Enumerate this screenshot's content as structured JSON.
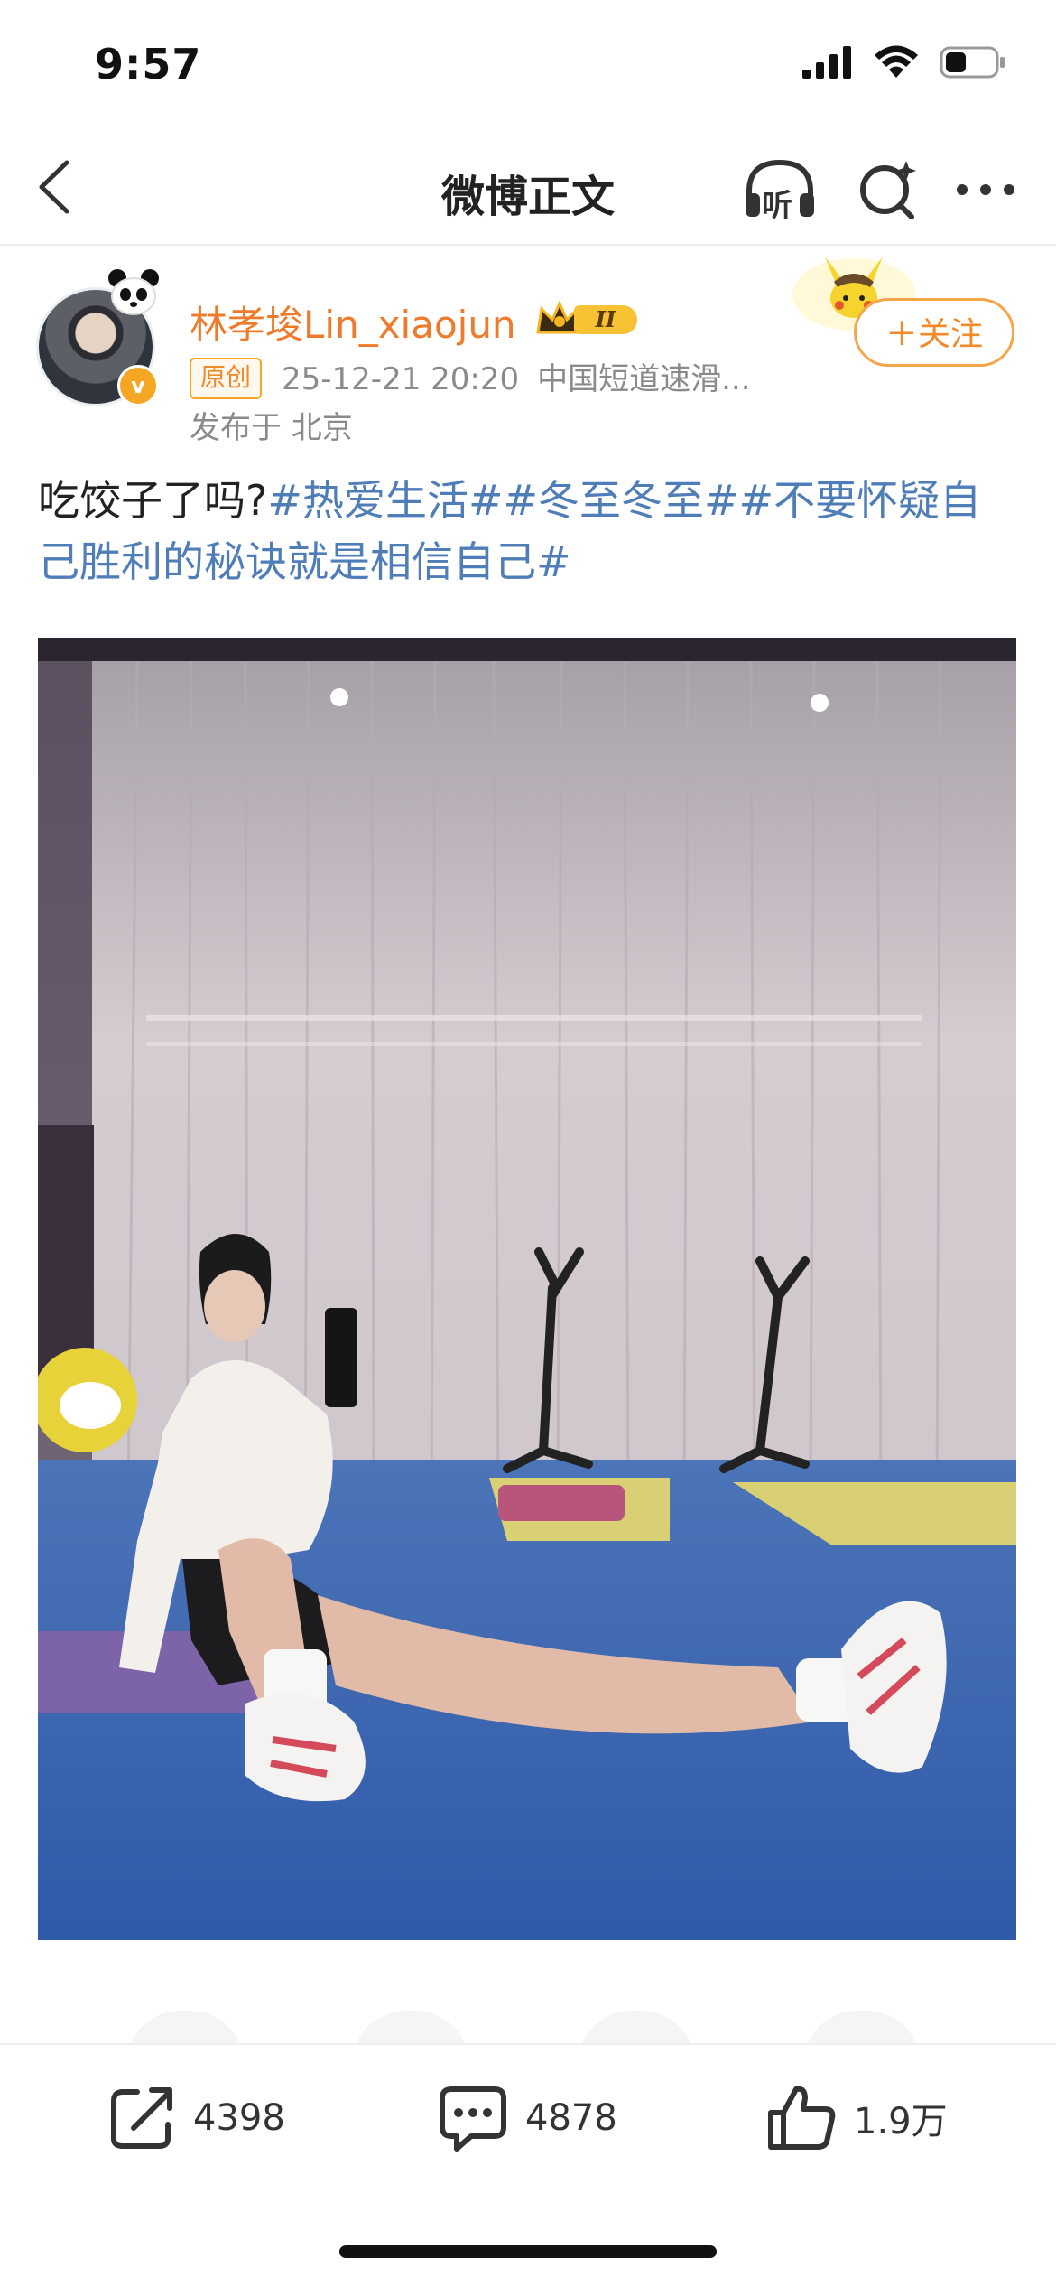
{
  "status_bar": {
    "time": "9:57"
  },
  "nav": {
    "title": "微博正文",
    "listen_label": "听"
  },
  "post": {
    "author": "林孝埈Lin_xiaojun",
    "vip_level": "II",
    "follow_label": "＋关注",
    "original_tag": "原创",
    "timestamp": "25-12-21 20:20",
    "source": "中国短道速滑...",
    "location": "发布于 北京",
    "text_plain": "吃饺子了吗?",
    "hashtags": [
      "#热爱生活#",
      "#冬至冬至#",
      "#不要怀疑自己胜利的秘诀就是相信自己#"
    ],
    "verified_mark": "v"
  },
  "actions": {
    "reposts": "4398",
    "comments": "4878",
    "likes": "1.9万"
  },
  "colors": {
    "accent_orange": "#ee7b2b",
    "hashtag_blue": "#4f7db8",
    "meta_gray": "#8a8a8a"
  }
}
